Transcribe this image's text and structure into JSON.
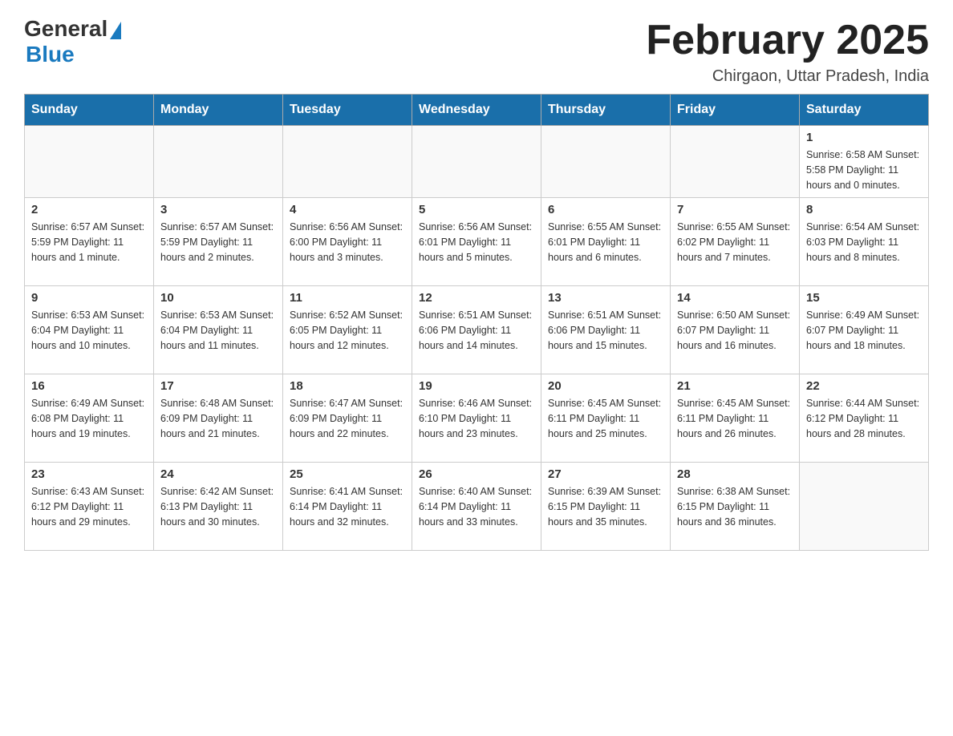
{
  "header": {
    "logo_general": "General",
    "logo_blue": "Blue",
    "month_title": "February 2025",
    "location": "Chirgaon, Uttar Pradesh, India"
  },
  "weekdays": [
    "Sunday",
    "Monday",
    "Tuesday",
    "Wednesday",
    "Thursday",
    "Friday",
    "Saturday"
  ],
  "weeks": [
    [
      {
        "day": "",
        "info": ""
      },
      {
        "day": "",
        "info": ""
      },
      {
        "day": "",
        "info": ""
      },
      {
        "day": "",
        "info": ""
      },
      {
        "day": "",
        "info": ""
      },
      {
        "day": "",
        "info": ""
      },
      {
        "day": "1",
        "info": "Sunrise: 6:58 AM\nSunset: 5:58 PM\nDaylight: 11 hours and 0 minutes."
      }
    ],
    [
      {
        "day": "2",
        "info": "Sunrise: 6:57 AM\nSunset: 5:59 PM\nDaylight: 11 hours and 1 minute."
      },
      {
        "day": "3",
        "info": "Sunrise: 6:57 AM\nSunset: 5:59 PM\nDaylight: 11 hours and 2 minutes."
      },
      {
        "day": "4",
        "info": "Sunrise: 6:56 AM\nSunset: 6:00 PM\nDaylight: 11 hours and 3 minutes."
      },
      {
        "day": "5",
        "info": "Sunrise: 6:56 AM\nSunset: 6:01 PM\nDaylight: 11 hours and 5 minutes."
      },
      {
        "day": "6",
        "info": "Sunrise: 6:55 AM\nSunset: 6:01 PM\nDaylight: 11 hours and 6 minutes."
      },
      {
        "day": "7",
        "info": "Sunrise: 6:55 AM\nSunset: 6:02 PM\nDaylight: 11 hours and 7 minutes."
      },
      {
        "day": "8",
        "info": "Sunrise: 6:54 AM\nSunset: 6:03 PM\nDaylight: 11 hours and 8 minutes."
      }
    ],
    [
      {
        "day": "9",
        "info": "Sunrise: 6:53 AM\nSunset: 6:04 PM\nDaylight: 11 hours and 10 minutes."
      },
      {
        "day": "10",
        "info": "Sunrise: 6:53 AM\nSunset: 6:04 PM\nDaylight: 11 hours and 11 minutes."
      },
      {
        "day": "11",
        "info": "Sunrise: 6:52 AM\nSunset: 6:05 PM\nDaylight: 11 hours and 12 minutes."
      },
      {
        "day": "12",
        "info": "Sunrise: 6:51 AM\nSunset: 6:06 PM\nDaylight: 11 hours and 14 minutes."
      },
      {
        "day": "13",
        "info": "Sunrise: 6:51 AM\nSunset: 6:06 PM\nDaylight: 11 hours and 15 minutes."
      },
      {
        "day": "14",
        "info": "Sunrise: 6:50 AM\nSunset: 6:07 PM\nDaylight: 11 hours and 16 minutes."
      },
      {
        "day": "15",
        "info": "Sunrise: 6:49 AM\nSunset: 6:07 PM\nDaylight: 11 hours and 18 minutes."
      }
    ],
    [
      {
        "day": "16",
        "info": "Sunrise: 6:49 AM\nSunset: 6:08 PM\nDaylight: 11 hours and 19 minutes."
      },
      {
        "day": "17",
        "info": "Sunrise: 6:48 AM\nSunset: 6:09 PM\nDaylight: 11 hours and 21 minutes."
      },
      {
        "day": "18",
        "info": "Sunrise: 6:47 AM\nSunset: 6:09 PM\nDaylight: 11 hours and 22 minutes."
      },
      {
        "day": "19",
        "info": "Sunrise: 6:46 AM\nSunset: 6:10 PM\nDaylight: 11 hours and 23 minutes."
      },
      {
        "day": "20",
        "info": "Sunrise: 6:45 AM\nSunset: 6:11 PM\nDaylight: 11 hours and 25 minutes."
      },
      {
        "day": "21",
        "info": "Sunrise: 6:45 AM\nSunset: 6:11 PM\nDaylight: 11 hours and 26 minutes."
      },
      {
        "day": "22",
        "info": "Sunrise: 6:44 AM\nSunset: 6:12 PM\nDaylight: 11 hours and 28 minutes."
      }
    ],
    [
      {
        "day": "23",
        "info": "Sunrise: 6:43 AM\nSunset: 6:12 PM\nDaylight: 11 hours and 29 minutes."
      },
      {
        "day": "24",
        "info": "Sunrise: 6:42 AM\nSunset: 6:13 PM\nDaylight: 11 hours and 30 minutes."
      },
      {
        "day": "25",
        "info": "Sunrise: 6:41 AM\nSunset: 6:14 PM\nDaylight: 11 hours and 32 minutes."
      },
      {
        "day": "26",
        "info": "Sunrise: 6:40 AM\nSunset: 6:14 PM\nDaylight: 11 hours and 33 minutes."
      },
      {
        "day": "27",
        "info": "Sunrise: 6:39 AM\nSunset: 6:15 PM\nDaylight: 11 hours and 35 minutes."
      },
      {
        "day": "28",
        "info": "Sunrise: 6:38 AM\nSunset: 6:15 PM\nDaylight: 11 hours and 36 minutes."
      },
      {
        "day": "",
        "info": ""
      }
    ]
  ]
}
